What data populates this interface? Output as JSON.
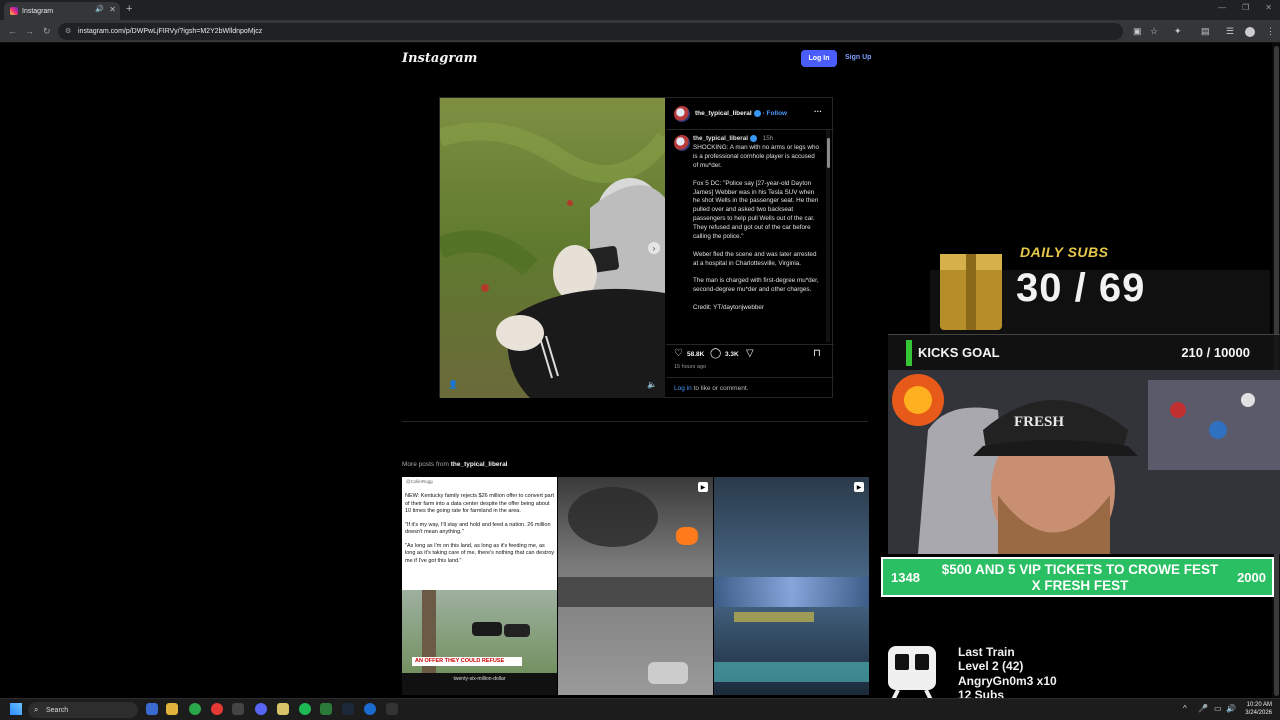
{
  "browser": {
    "tab_title": "Instagram",
    "url": "instagram.com/p/DWPwLjFIRVy/?igsh=M2Y2bWlldnpoMjcz",
    "new_tab_symbol": "+",
    "tab_close_symbol": "✕"
  },
  "header": {
    "logo": "Instagram",
    "login_label": "Log In",
    "signup_label": "Sign Up"
  },
  "post": {
    "author": "the_typical_liberal",
    "follow_label": "Follow",
    "more_symbol": "···",
    "caption_author": "the_typical_liberal",
    "caption_time": "15h",
    "caption_paragraphs": [
      "SHOCKING: A man with no arms or legs who is a professional cornhole player is accused of mu*der.",
      "Fox 5 DC: \"Police say [27-year-old Dayton James] Webber was in his Tesla SUV when he shot Wells in the passenger seat. He then pulled over and asked two backseat passengers to help pull Wells out of the car. They refused and got out of the car before calling the police.\"",
      "Weber fled the scene and was later arrested at a hospital in Charlottesville, Virginia.",
      "The man is charged with first-degree mu*der, second-degree mu*der and other charges.",
      "Credit: YT/daytonjwebber"
    ],
    "likes": "58.8K",
    "comments": "3.3K",
    "posted_ago": "15 hours ago",
    "login_link": "Log in",
    "login_suffix": " to like or comment."
  },
  "more_posts": {
    "label_prefix": "More posts from ",
    "label_author": "the_typical_liberal",
    "thumb1": {
      "handle": "@CollinRugg",
      "text1": "NEW: Kentucky family rejects $26 million offer to convert part of their farm into a data center despite the offer being about 10 times the going rate for farmland in the area.",
      "text2": "\"If it's my way, I'll stay and hold and feed a nation. 26 million doesn't mean anything.\"",
      "text3": "\"As long as I'm on this land, as long as it's feeding me, as long as it's taking care of me, there's nothing that can destroy me if I've got this land.\"",
      "banner": "AN OFFER THEY COULD REFUSE",
      "footer": "twenty-six-million-dollar"
    }
  },
  "overlay": {
    "daily_subs_title": "DAILY SUBS",
    "daily_subs_count": "30 / 69",
    "kicks_label": "KICKS GOAL",
    "kicks_count": "210 / 10000",
    "goal_left": "1348",
    "goal_text": "$500 AND 5 VIP TICKETS TO CROWE FEST X FRESH FEST",
    "goal_right": "2000",
    "hat_text": "FRESH",
    "train": {
      "title": "Last Train",
      "level": "Level 2  (42)",
      "user": "AngryGn0m3 x10",
      "subs": "12 Subs"
    }
  },
  "taskbar": {
    "search_label": "Search",
    "time": "10:20 AM",
    "date": "3/24/2026"
  },
  "colors": {
    "accent_blue": "#4a5df9",
    "link_blue": "#7ea0ff",
    "goal_green": "#2bbf63",
    "daily_gold": "#e8c94a"
  }
}
